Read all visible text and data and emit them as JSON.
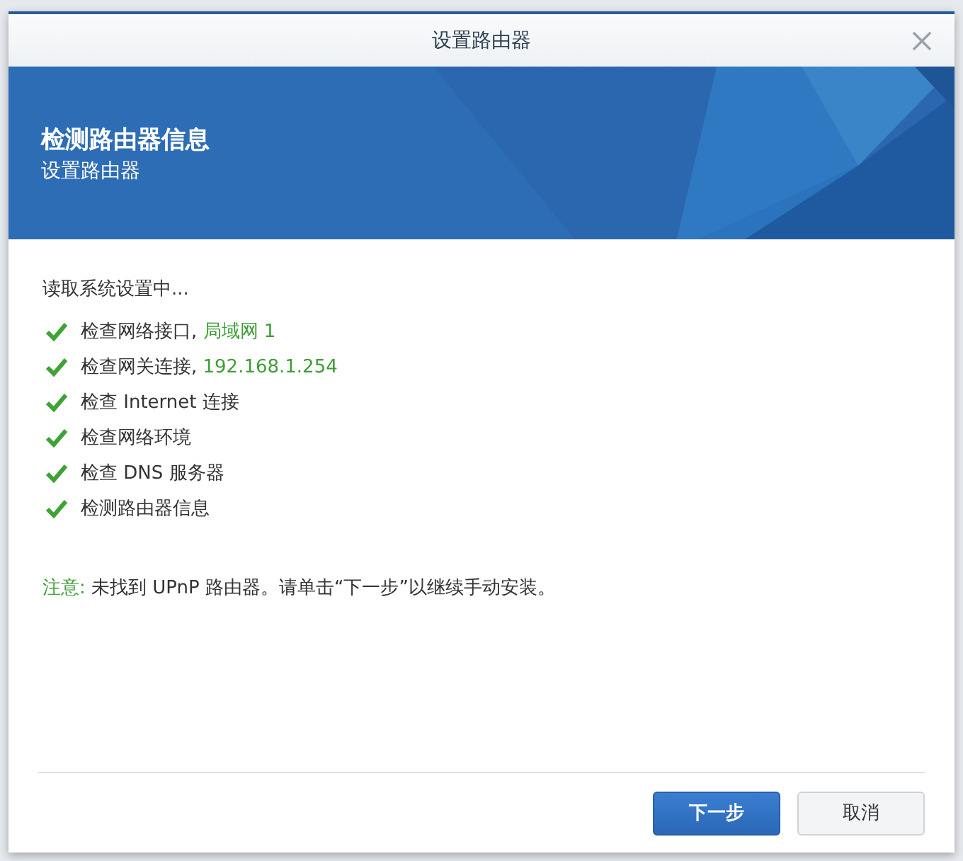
{
  "window": {
    "title": "设置路由器"
  },
  "banner": {
    "title": "检测路由器信息",
    "subtitle": "设置路由器"
  },
  "status": "读取系统设置中...",
  "checks": [
    {
      "label": "检查网络接口, ",
      "detail": "局域网 1",
      "done": true
    },
    {
      "label": "检查网关连接, ",
      "detail": "192.168.1.254",
      "done": true
    },
    {
      "label": "检查 Internet 连接",
      "done": true
    },
    {
      "label": "检查网络环境",
      "done": true
    },
    {
      "label": "检查 DNS 服务器",
      "done": true
    },
    {
      "label": "检测路由器信息",
      "done": true
    }
  ],
  "note": {
    "label": "注意: ",
    "text": "未找到 UPnP 路由器。请单击“下一步”以继续手动安装。"
  },
  "buttons": [
    {
      "label": "下一步",
      "kind": "primary"
    },
    {
      "label": "取消",
      "kind": "secondary"
    }
  ]
}
